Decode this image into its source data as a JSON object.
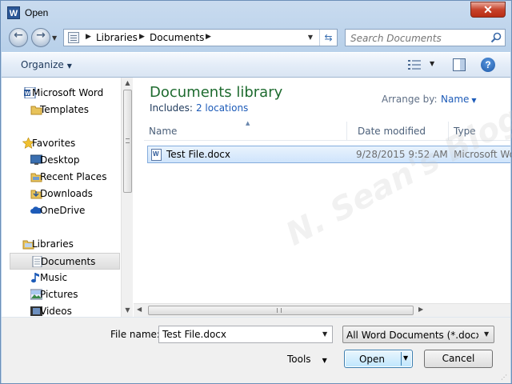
{
  "window": {
    "title": "Open",
    "app_icon_letter": "W",
    "close_glyph": "✕"
  },
  "nav": {
    "breadcrumbs": [
      "Libraries",
      "Documents"
    ],
    "search_placeholder": "Search Documents"
  },
  "toolbar": {
    "organize_label": "Organize",
    "help_glyph": "?"
  },
  "sidebar": {
    "items": [
      {
        "label": "Microsoft Word",
        "icon": "word-icon"
      },
      {
        "label": "Templates",
        "icon": "folder-icon"
      },
      {
        "label": "Favorites",
        "icon": "star-icon"
      },
      {
        "label": "Desktop",
        "icon": "desktop-icon"
      },
      {
        "label": "Recent Places",
        "icon": "recent-places-icon"
      },
      {
        "label": "Downloads",
        "icon": "downloads-icon"
      },
      {
        "label": "OneDrive",
        "icon": "cloud-icon"
      },
      {
        "label": "Libraries",
        "icon": "library-icon"
      },
      {
        "label": "Documents",
        "icon": "document-icon"
      },
      {
        "label": "Music",
        "icon": "music-icon"
      },
      {
        "label": "Pictures",
        "icon": "pictures-icon"
      },
      {
        "label": "Videos",
        "icon": "videos-icon"
      }
    ],
    "selected": "Documents"
  },
  "content": {
    "library_title": "Documents library",
    "includes_label": "Includes:",
    "includes_link": "2 locations",
    "arrange_label": "Arrange by:",
    "arrange_value": "Name",
    "columns": [
      "Name",
      "Date modified",
      "Type"
    ],
    "files": [
      {
        "name": "Test File.docx",
        "date_modified": "9/28/2015 9:52 AM",
        "type": "Microsoft Word"
      }
    ],
    "watermark": "N. Sean's Blog"
  },
  "footer": {
    "file_name_label": "File name:",
    "file_name_value": "Test File.docx",
    "file_type_value": "All Word Documents (*.docx;*.docm)",
    "tools_label": "Tools",
    "open_label": "Open",
    "cancel_label": "Cancel"
  },
  "colors": {
    "accent_blue": "#1d5bb8",
    "library_title_green": "#1e6b2f",
    "selection_border": "#84acdd",
    "close_red": "#c7432b"
  }
}
